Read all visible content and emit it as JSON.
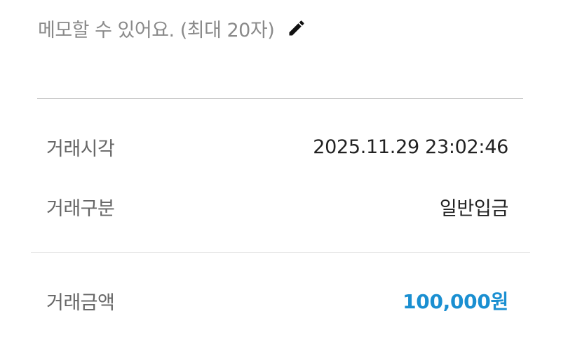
{
  "memo": {
    "placeholder": "메모할 수 있어요. (최대 20자)",
    "icon": "pencil-icon"
  },
  "details": {
    "time_label": "거래시각",
    "time_value": "2025.11.29 23:02:46",
    "type_label": "거래구분",
    "type_value": "일반입금",
    "amount_label": "거래금액",
    "amount_value": "100,000원"
  },
  "colors": {
    "amount": "#1a8fd1",
    "label": "#666666",
    "value": "#222222",
    "placeholder": "#8a8a8a"
  }
}
